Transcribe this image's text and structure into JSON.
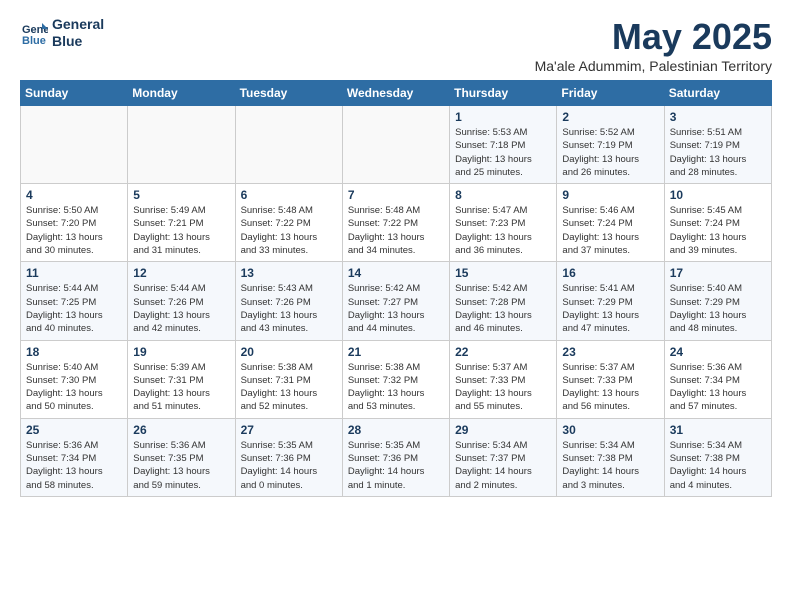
{
  "logo": {
    "line1": "General",
    "line2": "Blue"
  },
  "title": "May 2025",
  "subtitle": "Ma'ale Adummim, Palestinian Territory",
  "days_header": [
    "Sunday",
    "Monday",
    "Tuesday",
    "Wednesday",
    "Thursday",
    "Friday",
    "Saturday"
  ],
  "weeks": [
    [
      {
        "num": "",
        "info": ""
      },
      {
        "num": "",
        "info": ""
      },
      {
        "num": "",
        "info": ""
      },
      {
        "num": "",
        "info": ""
      },
      {
        "num": "1",
        "info": "Sunrise: 5:53 AM\nSunset: 7:18 PM\nDaylight: 13 hours\nand 25 minutes."
      },
      {
        "num": "2",
        "info": "Sunrise: 5:52 AM\nSunset: 7:19 PM\nDaylight: 13 hours\nand 26 minutes."
      },
      {
        "num": "3",
        "info": "Sunrise: 5:51 AM\nSunset: 7:19 PM\nDaylight: 13 hours\nand 28 minutes."
      }
    ],
    [
      {
        "num": "4",
        "info": "Sunrise: 5:50 AM\nSunset: 7:20 PM\nDaylight: 13 hours\nand 30 minutes."
      },
      {
        "num": "5",
        "info": "Sunrise: 5:49 AM\nSunset: 7:21 PM\nDaylight: 13 hours\nand 31 minutes."
      },
      {
        "num": "6",
        "info": "Sunrise: 5:48 AM\nSunset: 7:22 PM\nDaylight: 13 hours\nand 33 minutes."
      },
      {
        "num": "7",
        "info": "Sunrise: 5:48 AM\nSunset: 7:22 PM\nDaylight: 13 hours\nand 34 minutes."
      },
      {
        "num": "8",
        "info": "Sunrise: 5:47 AM\nSunset: 7:23 PM\nDaylight: 13 hours\nand 36 minutes."
      },
      {
        "num": "9",
        "info": "Sunrise: 5:46 AM\nSunset: 7:24 PM\nDaylight: 13 hours\nand 37 minutes."
      },
      {
        "num": "10",
        "info": "Sunrise: 5:45 AM\nSunset: 7:24 PM\nDaylight: 13 hours\nand 39 minutes."
      }
    ],
    [
      {
        "num": "11",
        "info": "Sunrise: 5:44 AM\nSunset: 7:25 PM\nDaylight: 13 hours\nand 40 minutes."
      },
      {
        "num": "12",
        "info": "Sunrise: 5:44 AM\nSunset: 7:26 PM\nDaylight: 13 hours\nand 42 minutes."
      },
      {
        "num": "13",
        "info": "Sunrise: 5:43 AM\nSunset: 7:26 PM\nDaylight: 13 hours\nand 43 minutes."
      },
      {
        "num": "14",
        "info": "Sunrise: 5:42 AM\nSunset: 7:27 PM\nDaylight: 13 hours\nand 44 minutes."
      },
      {
        "num": "15",
        "info": "Sunrise: 5:42 AM\nSunset: 7:28 PM\nDaylight: 13 hours\nand 46 minutes."
      },
      {
        "num": "16",
        "info": "Sunrise: 5:41 AM\nSunset: 7:29 PM\nDaylight: 13 hours\nand 47 minutes."
      },
      {
        "num": "17",
        "info": "Sunrise: 5:40 AM\nSunset: 7:29 PM\nDaylight: 13 hours\nand 48 minutes."
      }
    ],
    [
      {
        "num": "18",
        "info": "Sunrise: 5:40 AM\nSunset: 7:30 PM\nDaylight: 13 hours\nand 50 minutes."
      },
      {
        "num": "19",
        "info": "Sunrise: 5:39 AM\nSunset: 7:31 PM\nDaylight: 13 hours\nand 51 minutes."
      },
      {
        "num": "20",
        "info": "Sunrise: 5:38 AM\nSunset: 7:31 PM\nDaylight: 13 hours\nand 52 minutes."
      },
      {
        "num": "21",
        "info": "Sunrise: 5:38 AM\nSunset: 7:32 PM\nDaylight: 13 hours\nand 53 minutes."
      },
      {
        "num": "22",
        "info": "Sunrise: 5:37 AM\nSunset: 7:33 PM\nDaylight: 13 hours\nand 55 minutes."
      },
      {
        "num": "23",
        "info": "Sunrise: 5:37 AM\nSunset: 7:33 PM\nDaylight: 13 hours\nand 56 minutes."
      },
      {
        "num": "24",
        "info": "Sunrise: 5:36 AM\nSunset: 7:34 PM\nDaylight: 13 hours\nand 57 minutes."
      }
    ],
    [
      {
        "num": "25",
        "info": "Sunrise: 5:36 AM\nSunset: 7:34 PM\nDaylight: 13 hours\nand 58 minutes."
      },
      {
        "num": "26",
        "info": "Sunrise: 5:36 AM\nSunset: 7:35 PM\nDaylight: 13 hours\nand 59 minutes."
      },
      {
        "num": "27",
        "info": "Sunrise: 5:35 AM\nSunset: 7:36 PM\nDaylight: 14 hours\nand 0 minutes."
      },
      {
        "num": "28",
        "info": "Sunrise: 5:35 AM\nSunset: 7:36 PM\nDaylight: 14 hours\nand 1 minute."
      },
      {
        "num": "29",
        "info": "Sunrise: 5:34 AM\nSunset: 7:37 PM\nDaylight: 14 hours\nand 2 minutes."
      },
      {
        "num": "30",
        "info": "Sunrise: 5:34 AM\nSunset: 7:38 PM\nDaylight: 14 hours\nand 3 minutes."
      },
      {
        "num": "31",
        "info": "Sunrise: 5:34 AM\nSunset: 7:38 PM\nDaylight: 14 hours\nand 4 minutes."
      }
    ]
  ]
}
